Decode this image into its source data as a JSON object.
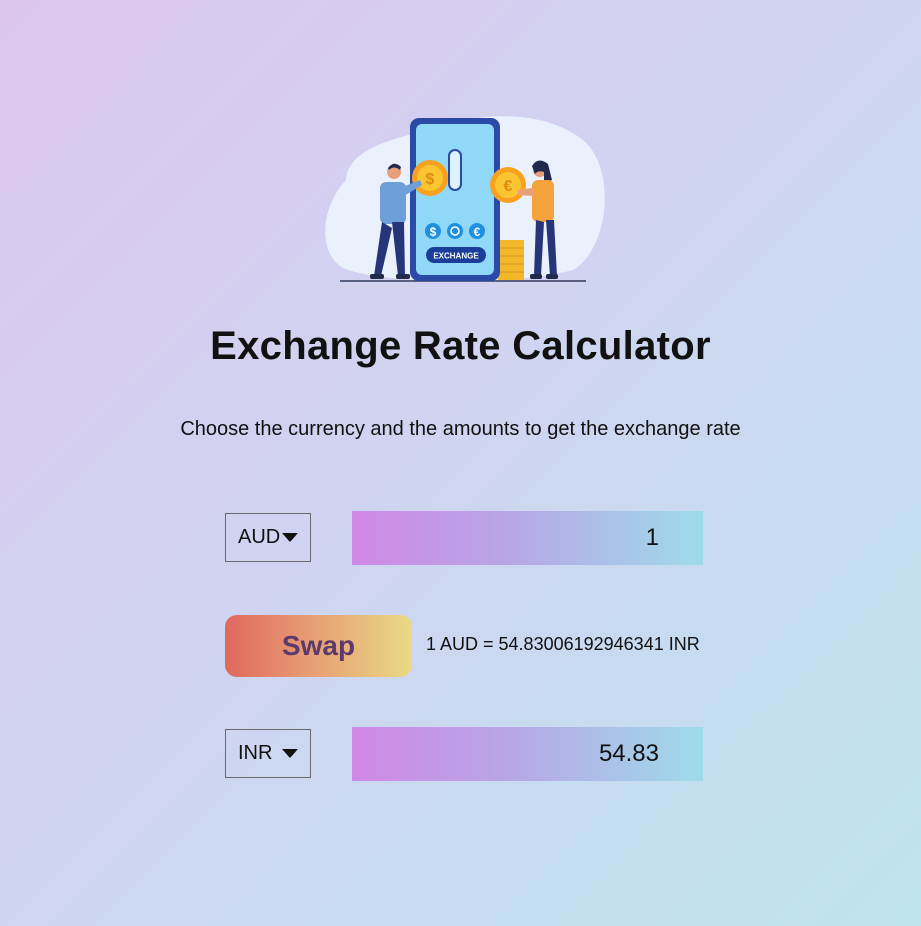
{
  "header": {
    "title": "Exchange Rate Calculator",
    "subtitle": "Choose the currency and the amounts to get the exchange rate"
  },
  "illustration": {
    "phone_label": "EXCHANGE",
    "symbols": [
      "$",
      "€"
    ]
  },
  "converter": {
    "from": {
      "currency": "AUD",
      "amount": "1"
    },
    "to": {
      "currency": "INR",
      "amount": "54.83"
    },
    "swap_label": "Swap",
    "rate_text": "1 AUD = 54.83006192946341 INR"
  },
  "colors": {
    "swap_text": "#5c3a6b",
    "amount_gradient_start": "#cf88e6",
    "amount_gradient_end": "#9edbe9",
    "swap_gradient_start": "#e0685e",
    "swap_gradient_end": "#e9da84"
  },
  "icons": {
    "select_caret": "caret-down-icon"
  }
}
